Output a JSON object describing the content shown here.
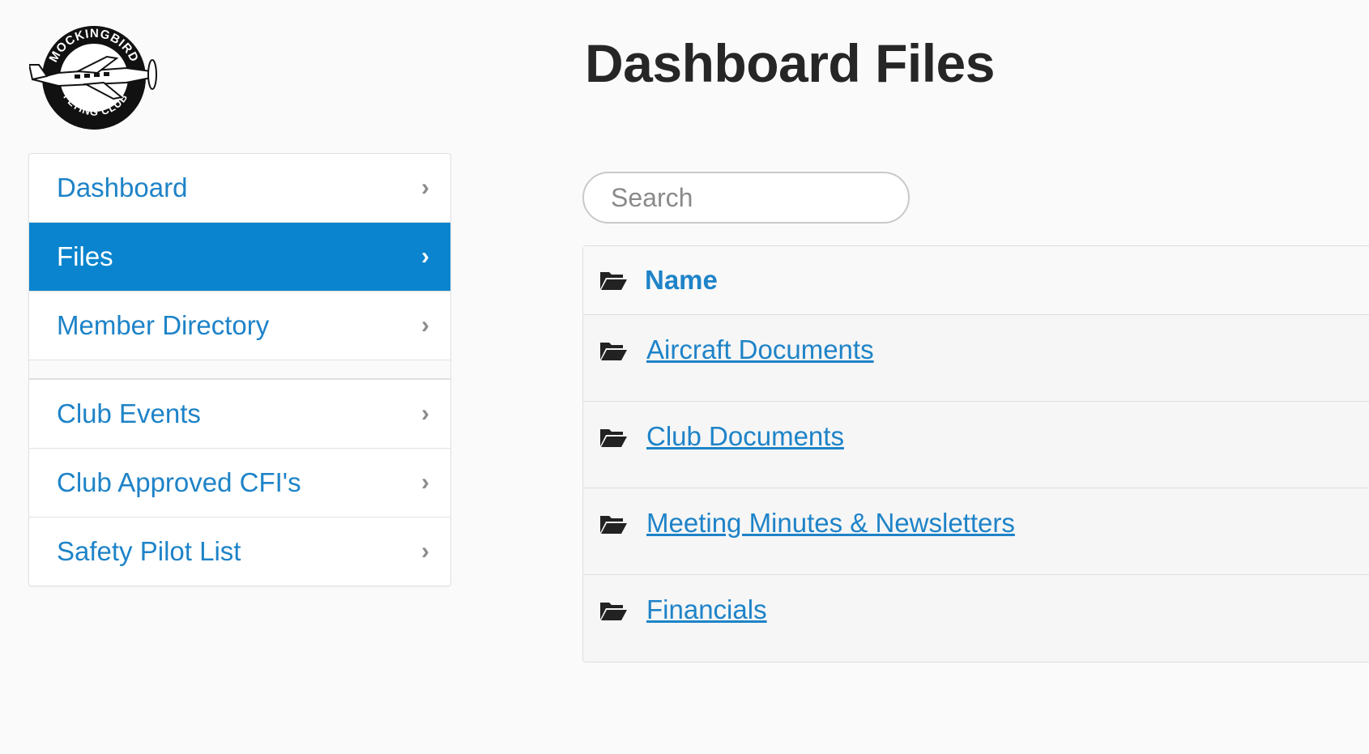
{
  "logo": {
    "top_text": "MOCKINGBIRD",
    "bottom_text": "FLYING CLUB",
    "icon": "airplane-icon"
  },
  "sidebar": {
    "group1": [
      {
        "label": "Dashboard",
        "active": false
      },
      {
        "label": "Files",
        "active": true
      },
      {
        "label": "Member Directory",
        "active": false
      }
    ],
    "group2": [
      {
        "label": "Club Events",
        "active": false
      },
      {
        "label": "Club Approved CFI's",
        "active": false
      },
      {
        "label": "Safety Pilot List",
        "active": false
      }
    ],
    "chevron": "chevron-right-icon"
  },
  "main": {
    "title": "Dashboard Files",
    "search": {
      "placeholder": "Search",
      "value": ""
    },
    "table": {
      "header": "Name",
      "rows": [
        {
          "name": "Aircraft Documents"
        },
        {
          "name": "Club Documents"
        },
        {
          "name": "Meeting Minutes & Newsletters"
        },
        {
          "name": "Financials"
        }
      ]
    }
  },
  "colors": {
    "accent": "#0a84ce",
    "link": "#1e83c8",
    "title": "#262626"
  }
}
